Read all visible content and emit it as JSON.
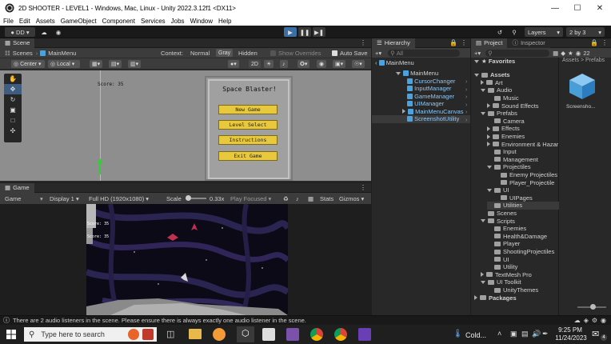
{
  "window": {
    "title": "2D SHOOTER - LEVEL1 - Windows, Mac, Linux - Unity 2022.3.12f1 <DX11>"
  },
  "menu": [
    "File",
    "Edit",
    "Assets",
    "GameObject",
    "Component",
    "Services",
    "Jobs",
    "Window",
    "Help"
  ],
  "toolbar": {
    "account": "DD",
    "layers": "Layers",
    "layout": "2 by 3"
  },
  "scene": {
    "tab": "Scene",
    "scenes_label": "Scenes",
    "scene_name": "MainMenu",
    "context_label": "Context:",
    "ctx_normal": "Normal",
    "ctx_gray": "Gray",
    "ctx_hidden": "Hidden",
    "show_overrides": "Show Overrides",
    "auto_save": "Auto Save",
    "pivot": "Center",
    "space": "Local",
    "mode_2d": "2D",
    "score": "Score: 35",
    "menu_title": "Space Blaster!",
    "buttons": [
      "New Game",
      "Level Select",
      "Instructions",
      "Exit Game"
    ]
  },
  "game": {
    "tab": "Game",
    "view": "Game",
    "display": "Display 1",
    "resolution": "Full HD (1920x1080)",
    "scale_label": "Scale",
    "scale_value": "0.33x",
    "play_mode": "Play Focused",
    "stats": "Stats",
    "gizmos": "Gizmos",
    "score1": "Score: 35",
    "score2": "Score: 35"
  },
  "hierarchy": {
    "tab": "Hierarchy",
    "search": "All",
    "root": "MainMenu",
    "items": [
      "MainMenu",
      "CursorChanger",
      "InputManager",
      "GameManager",
      "UIManager",
      "MainMenuCanvas",
      "ScreenshotUtility"
    ]
  },
  "project": {
    "tab": "Project",
    "inspector_tab": "Inspector",
    "count": "22",
    "breadcrumb": "Assets > Prefabs",
    "favorites": "Favorites",
    "tree": [
      {
        "label": "Assets",
        "depth": 0,
        "open": true
      },
      {
        "label": "Art",
        "depth": 1,
        "open": false
      },
      {
        "label": "Audio",
        "depth": 1,
        "open": true
      },
      {
        "label": "Music",
        "depth": 2,
        "open": null
      },
      {
        "label": "Sound Effects",
        "depth": 2,
        "open": false
      },
      {
        "label": "Prefabs",
        "depth": 1,
        "open": true
      },
      {
        "label": "Camera",
        "depth": 2,
        "open": null
      },
      {
        "label": "Effects",
        "depth": 2,
        "open": false
      },
      {
        "label": "Enemies",
        "depth": 2,
        "open": false
      },
      {
        "label": "Environment & Hazar",
        "depth": 2,
        "open": false
      },
      {
        "label": "Input",
        "depth": 2,
        "open": null
      },
      {
        "label": "Management",
        "depth": 2,
        "open": null
      },
      {
        "label": "Projectiles",
        "depth": 2,
        "open": true
      },
      {
        "label": "Enemy Projectiles",
        "depth": 3,
        "open": null
      },
      {
        "label": "Player_Projectile",
        "depth": 3,
        "open": null
      },
      {
        "label": "UI",
        "depth": 2,
        "open": true
      },
      {
        "label": "UIPages",
        "depth": 3,
        "open": null
      },
      {
        "label": "Utilities",
        "depth": 2,
        "open": null
      },
      {
        "label": "Scenes",
        "depth": 1,
        "open": null
      },
      {
        "label": "Scripts",
        "depth": 1,
        "open": true
      },
      {
        "label": "Enemies",
        "depth": 2,
        "open": null
      },
      {
        "label": "Health&Damage",
        "depth": 2,
        "open": null
      },
      {
        "label": "Player",
        "depth": 2,
        "open": null
      },
      {
        "label": "ShootingProjectiles",
        "depth": 2,
        "open": null
      },
      {
        "label": "UI",
        "depth": 2,
        "open": null
      },
      {
        "label": "Utility",
        "depth": 2,
        "open": null
      },
      {
        "label": "TextMesh Pro",
        "depth": 1,
        "open": false
      },
      {
        "label": "UI Toolkit",
        "depth": 1,
        "open": true
      },
      {
        "label": "UnityThemes",
        "depth": 2,
        "open": null
      },
      {
        "label": "Packages",
        "depth": 0,
        "open": false
      }
    ],
    "asset_name": "Screensho..."
  },
  "status": {
    "message": "There are 2 audio listeners in the scene. Please ensure there is always exactly one audio listener in the scene."
  },
  "taskbar": {
    "search_placeholder": "Type here to search",
    "weather": "Cold...",
    "time": "9:25 PM",
    "date": "11/24/2023",
    "notifications": "4"
  }
}
